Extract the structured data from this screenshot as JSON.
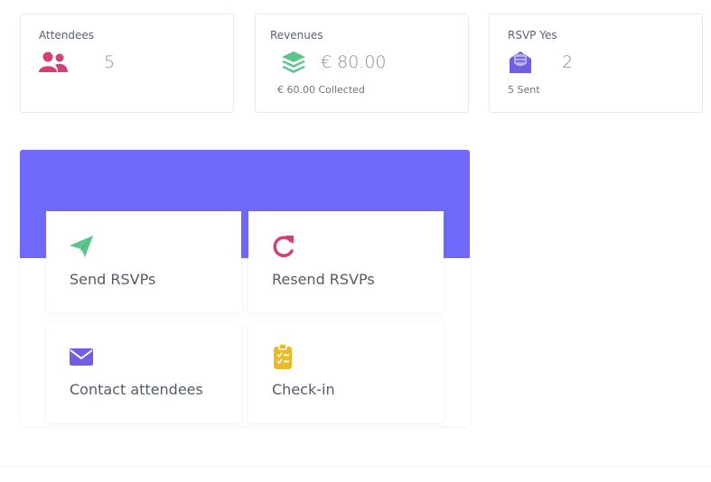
{
  "stats": {
    "attendees": {
      "label": "Attendees",
      "value": "5",
      "icon": "users-icon"
    },
    "revenues": {
      "label": "Revenues",
      "value": "€ 80.00",
      "sub": "€ 60.00 Collected",
      "icon": "layers-icon"
    },
    "rsvp": {
      "label": "RSVP Yes",
      "value": "2",
      "sub": "5 Sent",
      "icon": "envelope-open-icon"
    }
  },
  "actions": {
    "send_rsvps": {
      "label": "Send RSVPs",
      "icon": "paper-plane-icon"
    },
    "resend_rsvps": {
      "label": "Resend RSVPs",
      "icon": "redo-icon"
    },
    "contact_attendees": {
      "label": "Contact attendees",
      "icon": "envelope-icon"
    },
    "check_in": {
      "label": "Check-in",
      "icon": "clipboard-check-icon"
    }
  },
  "colors": {
    "banner": "#6f6afc",
    "pink": "#d2407a",
    "green": "#5cc48d",
    "purple": "#6f5fe3",
    "yellow": "#e9bb2b"
  }
}
